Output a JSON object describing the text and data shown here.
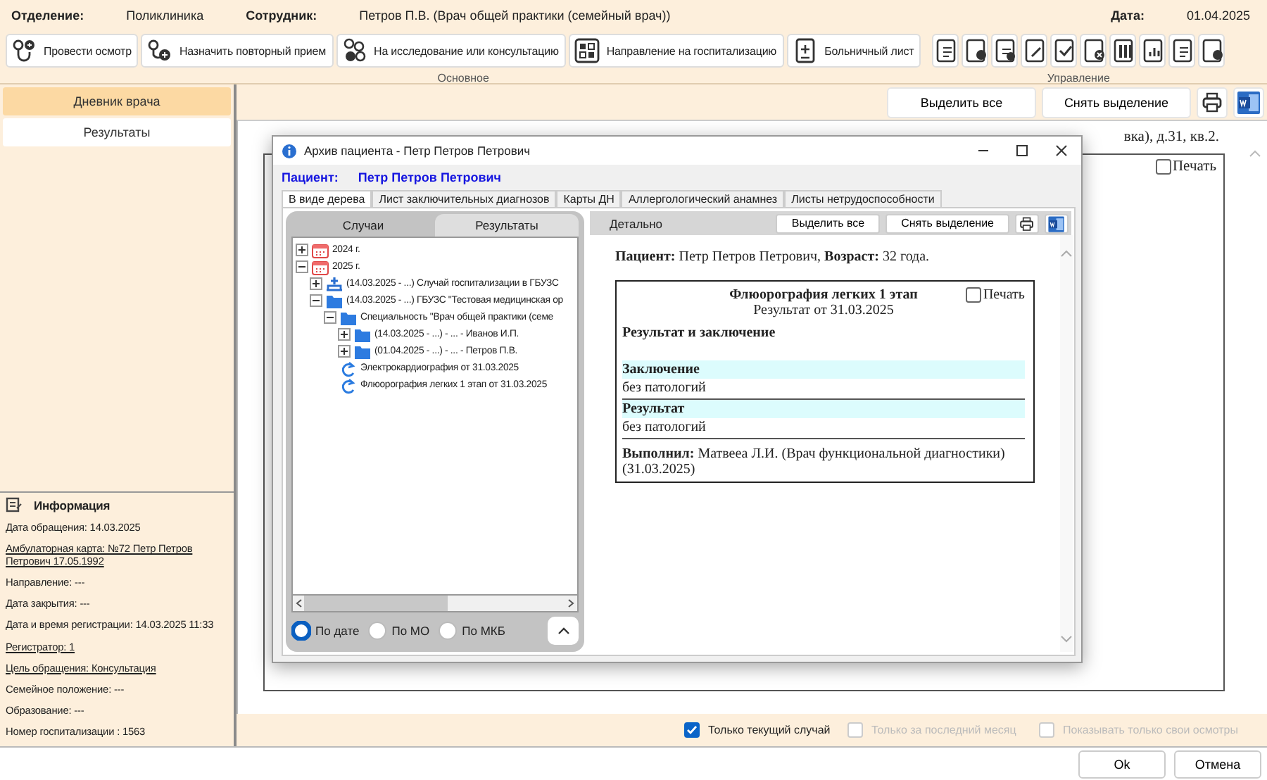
{
  "header": {
    "department_label": "Отделение:",
    "department": "Поликлиника",
    "employee_label": "Сотрудник:",
    "employee": "Петров П.В. (Врач общей практики (семейный врач))",
    "date_label": "Дата:",
    "date": "01.04.2025"
  },
  "toolbar": {
    "buttons": [
      "Провести осмотр",
      "Назначить повторный прием",
      "На исследование или консультацию",
      "Направление на госпитализацию",
      "Больничный лист"
    ],
    "main_group": "Основное",
    "manage_group": "Управление"
  },
  "sidebar": {
    "tabs": [
      {
        "label": "Дневник врача",
        "selected": true
      },
      {
        "label": "Результаты",
        "selected": false
      }
    ],
    "info": {
      "title": "Информация",
      "items": [
        {
          "text": "Дата обращения: 14.03.2025",
          "link": false
        },
        {
          "text": "Амбулаторная карта: №72 Петр Петров Петрович 17.05.1992",
          "link": true
        },
        {
          "text": "Направление: ---",
          "link": false
        },
        {
          "text": "Дата закрытия: ---",
          "link": false
        },
        {
          "text": "Дата и время регистрации: 14.03.2025 11:33",
          "link": false
        },
        {
          "text": "Регистратор: 1",
          "link": true
        },
        {
          "text": "Цель обращения: Консультация",
          "link": true
        },
        {
          "text": "Семейное положение: ---",
          "link": false
        },
        {
          "text": "Образование: ---",
          "link": false
        },
        {
          "text": "Номер госпитализации : 1563",
          "link": false
        }
      ]
    }
  },
  "document": {
    "buttons": [
      "Выделить все",
      "Снять выделение"
    ],
    "address_tail": "вка), д.31, кв.2.",
    "print": {
      "label": "Печать",
      "checked": false
    }
  },
  "dialog": {
    "title": "Архив пациента - Петр Петров Петрович",
    "patient_label": "Пациент:",
    "patient": "Петр Петров Петрович",
    "tabs": [
      {
        "label": "В виде дерева",
        "selected": true
      },
      {
        "label": "Лист заключительных диагнозов",
        "selected": false
      },
      {
        "label": "Карты ДН",
        "selected": false
      },
      {
        "label": "Аллергологический анамнез",
        "selected": false
      },
      {
        "label": "Листы нетрудоспособности",
        "selected": false
      }
    ],
    "left_tabs": [
      {
        "label": "Случаи",
        "selected": true
      },
      {
        "label": "Результаты",
        "selected": false
      }
    ],
    "tree": [
      {
        "kind": "calendar",
        "label": "2024 г.",
        "expanded": false
      },
      {
        "kind": "calendar",
        "label": "2025 г.",
        "expanded": true,
        "children": [
          {
            "kind": "hospital",
            "label": "(14.03.2025 - ...) Случай госпитализации в ГБУЗС",
            "expanded": false
          },
          {
            "kind": "folder",
            "label": "(14.03.2025 - ...) ГБУЗС \"Тестовая медицинская ор",
            "expanded": true,
            "children": [
              {
                "kind": "folder",
                "label": "Специальность \"Врач общей практики (семе",
                "expanded": true,
                "children": [
                  {
                    "kind": "folder",
                    "label": "(14.03.2025 - ...) - ... - Иванов И.П.",
                    "expanded": false
                  },
                  {
                    "kind": "folder",
                    "label": "(01.04.2025 - ...) - ... - Петров П.В.",
                    "expanded": false
                  }
                ]
              },
              {
                "kind": "result",
                "label": "Электрокардиография от 31.03.2025"
              },
              {
                "kind": "result",
                "label": "Флюорография легких 1 этап от 31.03.2025"
              }
            ]
          }
        ]
      }
    ],
    "sort_options": [
      {
        "label": "По дате",
        "selected": true
      },
      {
        "label": "По МО",
        "selected": false
      },
      {
        "label": "По МКБ",
        "selected": false
      }
    ],
    "detail": {
      "title": "Детально",
      "buttons": [
        "Выделить все",
        "Снять выделение"
      ],
      "patient_line": "**Пациент:** Петр Петров Петрович, **Возраст:** 32 года.",
      "report": {
        "title": "Флюорография легких 1 этап",
        "subtitle": "Результат от 31.03.2025",
        "print": {
          "label": "Печать",
          "checked": false
        },
        "section": "Результат и заключение",
        "fields": [
          {
            "label": "Заключение",
            "value": "без патологий"
          },
          {
            "label": "Результат",
            "value": "без патологий"
          }
        ],
        "performer": "**Выполнил:** Матвееа Л.И. (Врач функциональной диагностики) (31.03.2025)"
      }
    }
  },
  "filters": [
    {
      "label": "Только текущий случай",
      "checked": true,
      "disabled": false
    },
    {
      "label": "Только за последний месяц",
      "checked": false,
      "disabled": true
    },
    {
      "label": "Показывать только свои осмотры",
      "checked": false,
      "disabled": true
    }
  ],
  "footer": {
    "buttons": [
      "Ok",
      "Отмена"
    ]
  }
}
